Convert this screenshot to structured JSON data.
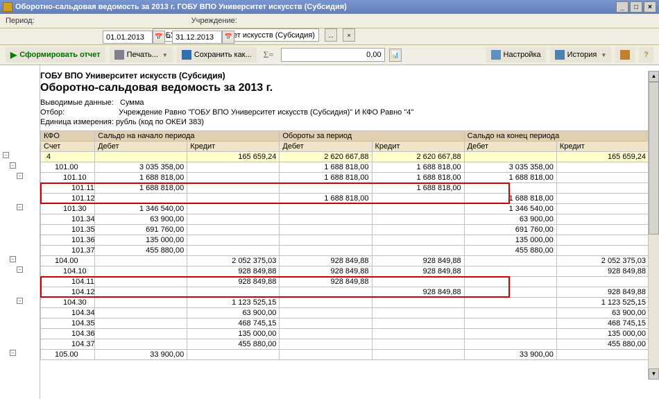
{
  "window": {
    "title": "Оборотно-сальдовая ведомость за 2013 г. ГОБУ ВПО Университет искусств (Субсидия)"
  },
  "params": {
    "period_label": "Период:",
    "date_from": "01.01.2013",
    "date_to": "31.12.2013",
    "institution_label": "Учреждение:",
    "institution": "ГОБУ ВПО Университет искусств (Субсидия)"
  },
  "toolbar": {
    "form_report": "Сформировать отчет",
    "print": "Печать...",
    "save_as": "Сохранить как...",
    "sum_value": "0,00",
    "settings": "Настройка",
    "history": "История"
  },
  "report": {
    "org": "ГОБУ ВПО Университет искусств (Субсидия)",
    "title": "Оборотно-сальдовая ведомость за 2013 г.",
    "output_label": "Выводимые данные:",
    "output_value": "Сумма",
    "filter_label": "Отбор:",
    "filter_value": "Учреждение Равно \"ГОБУ ВПО Университет искусств (Субсидия)\" И КФО Равно \"4\"",
    "unit_label": "Единица измерения: рубль (код по ОКЕИ 383)"
  },
  "headers": {
    "kfo": "КФО",
    "account": "Счет",
    "start": "Сальдо на начало периода",
    "turnover": "Обороты за период",
    "end": "Сальдо на конец периода",
    "debit": "Дебет",
    "credit": "Кредит"
  },
  "rows": [
    {
      "lvl": 0,
      "acct": "4",
      "sd": "",
      "sc": "165 659,24",
      "td": "2 620 667,88",
      "tc": "2 620 667,88",
      "ed": "",
      "ec": "165 659,24",
      "yel": true
    },
    {
      "lvl": 1,
      "acct": "101.00",
      "sd": "3 035 358,00",
      "sc": "",
      "td": "1 688 818,00",
      "tc": "1 688 818,00",
      "ed": "3 035 358,00",
      "ec": ""
    },
    {
      "lvl": 2,
      "acct": "101.10",
      "sd": "1 688 818,00",
      "sc": "",
      "td": "1 688 818,00",
      "tc": "1 688 818,00",
      "ed": "1 688 818,00",
      "ec": ""
    },
    {
      "lvl": 3,
      "acct": "101.11",
      "sd": "1 688 818,00",
      "sc": "",
      "td": "",
      "tc": "1 688 818,00",
      "ed": "",
      "ec": ""
    },
    {
      "lvl": 3,
      "acct": "101.12",
      "sd": "",
      "sc": "",
      "td": "1 688 818,00",
      "tc": "",
      "ed": "1 688 818,00",
      "ec": ""
    },
    {
      "lvl": 2,
      "acct": "101.30",
      "sd": "1 346 540,00",
      "sc": "",
      "td": "",
      "tc": "",
      "ed": "1 346 540,00",
      "ec": ""
    },
    {
      "lvl": 3,
      "acct": "101.34",
      "sd": "63 900,00",
      "sc": "",
      "td": "",
      "tc": "",
      "ed": "63 900,00",
      "ec": ""
    },
    {
      "lvl": 3,
      "acct": "101.35",
      "sd": "691 760,00",
      "sc": "",
      "td": "",
      "tc": "",
      "ed": "691 760,00",
      "ec": ""
    },
    {
      "lvl": 3,
      "acct": "101.36",
      "sd": "135 000,00",
      "sc": "",
      "td": "",
      "tc": "",
      "ed": "135 000,00",
      "ec": ""
    },
    {
      "lvl": 3,
      "acct": "101.37",
      "sd": "455 880,00",
      "sc": "",
      "td": "",
      "tc": "",
      "ed": "455 880,00",
      "ec": ""
    },
    {
      "lvl": 1,
      "acct": "104.00",
      "sd": "",
      "sc": "2 052 375,03",
      "td": "928 849,88",
      "tc": "928 849,88",
      "ed": "",
      "ec": "2 052 375,03"
    },
    {
      "lvl": 2,
      "acct": "104.10",
      "sd": "",
      "sc": "928 849,88",
      "td": "928 849,88",
      "tc": "928 849,88",
      "ed": "",
      "ec": "928 849,88"
    },
    {
      "lvl": 3,
      "acct": "104.11",
      "sd": "",
      "sc": "928 849,88",
      "td": "928 849,88",
      "tc": "",
      "ed": "",
      "ec": ""
    },
    {
      "lvl": 3,
      "acct": "104.12",
      "sd": "",
      "sc": "",
      "td": "",
      "tc": "928 849,88",
      "ed": "",
      "ec": "928 849,88"
    },
    {
      "lvl": 2,
      "acct": "104.30",
      "sd": "",
      "sc": "1 123 525,15",
      "td": "",
      "tc": "",
      "ed": "",
      "ec": "1 123 525,15"
    },
    {
      "lvl": 3,
      "acct": "104.34",
      "sd": "",
      "sc": "63 900,00",
      "td": "",
      "tc": "",
      "ed": "",
      "ec": "63 900,00"
    },
    {
      "lvl": 3,
      "acct": "104.35",
      "sd": "",
      "sc": "468 745,15",
      "td": "",
      "tc": "",
      "ed": "",
      "ec": "468 745,15"
    },
    {
      "lvl": 3,
      "acct": "104.36",
      "sd": "",
      "sc": "135 000,00",
      "td": "",
      "tc": "",
      "ed": "",
      "ec": "135 000,00"
    },
    {
      "lvl": 3,
      "acct": "104.37",
      "sd": "",
      "sc": "455 880,00",
      "td": "",
      "tc": "",
      "ed": "",
      "ec": "455 880,00"
    },
    {
      "lvl": 1,
      "acct": "105.00",
      "sd": "33 900,00",
      "sc": "",
      "td": "",
      "tc": "",
      "ed": "33 900,00",
      "ec": ""
    }
  ],
  "tree": [
    {
      "pad": 4,
      "sym": "−"
    },
    {
      "pad": 14,
      "sym": "−"
    },
    {
      "pad": 24,
      "sym": "−"
    },
    {
      "pad": 34,
      "sym": ""
    },
    {
      "pad": 34,
      "sym": ""
    },
    {
      "pad": 24,
      "sym": "−"
    },
    {
      "pad": 34,
      "sym": ""
    },
    {
      "pad": 34,
      "sym": ""
    },
    {
      "pad": 34,
      "sym": ""
    },
    {
      "pad": 34,
      "sym": ""
    },
    {
      "pad": 14,
      "sym": "−"
    },
    {
      "pad": 24,
      "sym": "−"
    },
    {
      "pad": 34,
      "sym": ""
    },
    {
      "pad": 34,
      "sym": ""
    },
    {
      "pad": 24,
      "sym": "−"
    },
    {
      "pad": 34,
      "sym": ""
    },
    {
      "pad": 34,
      "sym": ""
    },
    {
      "pad": 34,
      "sym": ""
    },
    {
      "pad": 34,
      "sym": ""
    },
    {
      "pad": 14,
      "sym": "−"
    }
  ]
}
